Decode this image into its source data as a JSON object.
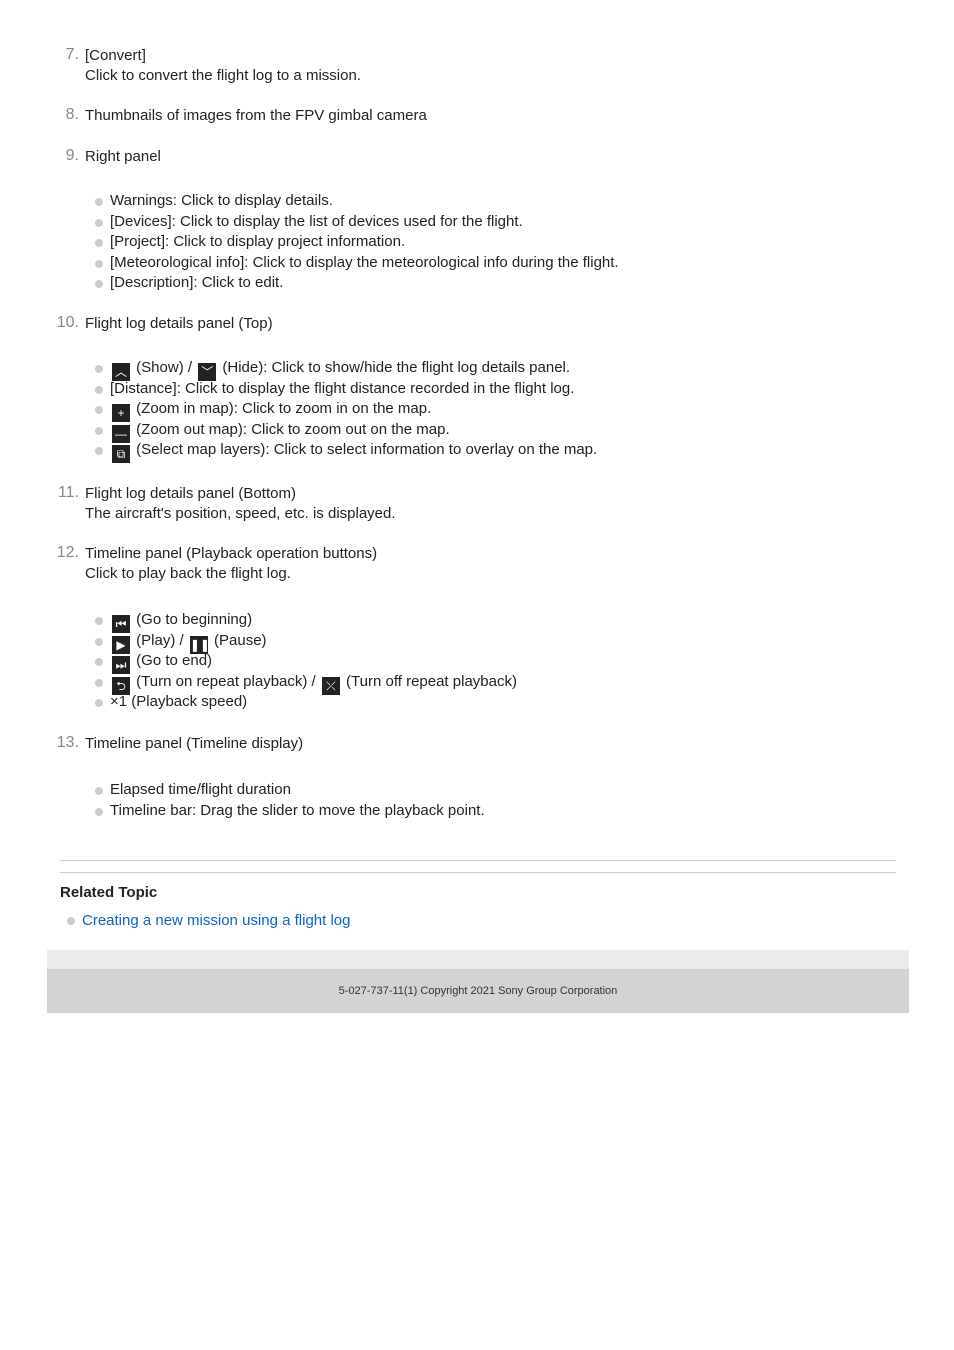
{
  "steps": [
    {
      "num": "7.",
      "lines": [
        "[Convert]",
        "Click to convert the flight log to a mission."
      ]
    },
    {
      "num": "8.",
      "lines": [
        "Thumbnails of images from the FPV gimbal camera"
      ]
    },
    {
      "num": "9.",
      "lines": [
        "Right panel"
      ],
      "bullets": [
        "Warnings: Click to display details.",
        "[Devices]: Click to display the list of devices used for the flight.",
        "[Project]: Click to display project information.",
        "[Meteorological info]: Click to display the meteorological info during the flight.",
        "[Description]: Click to edit."
      ]
    },
    {
      "num": "10.",
      "lines": [
        "Flight log details panel (Top)"
      ],
      "bullets": [
        "(Show) /",
        "(Hide): Click to show/hide the flight log details panel.",
        "[Distance]: Click to display the flight distance recorded in the flight log.",
        "(Zoom in map): Click to zoom in on the map.",
        "(Zoom out map): Click to zoom out on the map.",
        "(Select map layers): Click to select information to overlay on the map."
      ]
    },
    {
      "num": "11.",
      "lines": [
        "Flight log details panel (Bottom)",
        "The aircraft's position, speed, etc. is displayed."
      ]
    },
    {
      "num": "12.",
      "lines": [
        "Timeline panel (Playback operation buttons)",
        "Click to play back the flight log."
      ],
      "bullets": [
        "(Go to beginning)",
        "(Play) /",
        "(Pause)",
        "(Go to end)",
        "(Turn on repeat playback) /",
        "(Turn off repeat playback)",
        "×1 (Playback speed)"
      ]
    },
    {
      "num": "13.",
      "lines": [
        "Timeline panel (Timeline display)"
      ],
      "bullets": [
        "Elapsed time/flight duration",
        "Timeline bar: Drag the slider to move the playback point."
      ]
    }
  ],
  "related": {
    "title": "Related Topic",
    "links": [
      "Creating a new mission using a flight log"
    ]
  },
  "footer": {
    "copyright": "5-027-737-11(1) Copyright 2021 Sony Group Corporation"
  }
}
